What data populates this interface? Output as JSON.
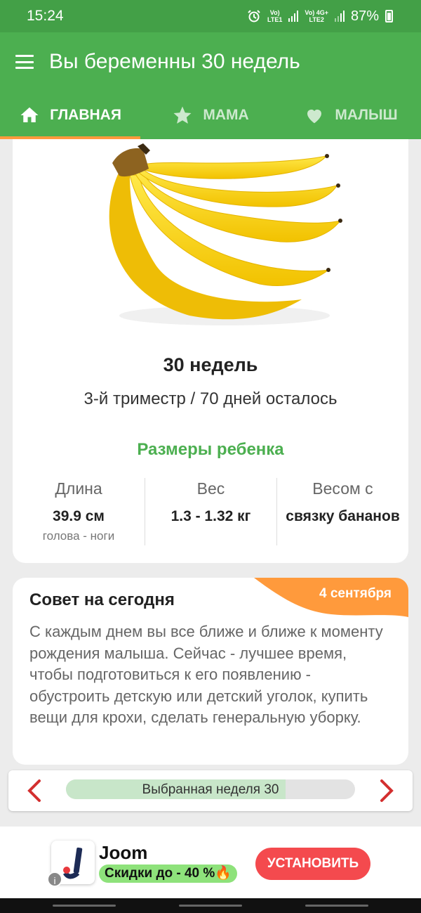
{
  "status_bar": {
    "time": "15:24",
    "net1_top": "Vo)",
    "net1_bottom": "LTE1",
    "net2_top": "Vo) 4G+",
    "net2_bottom": "LTE2",
    "battery": "87%",
    "icons": [
      "alarm-icon",
      "signal-icon",
      "signal-icon",
      "battery-charging-icon"
    ]
  },
  "app_bar": {
    "title": "Вы беременны 30 недель",
    "menu_icon": "hamburger-icon"
  },
  "tabs": [
    {
      "label": "ГЛАВНАЯ",
      "icon": "home-icon",
      "active": true
    },
    {
      "label": "МАМА",
      "icon": "star-icon",
      "active": false
    },
    {
      "label": "МАЛЫШ",
      "icon": "heart-icon",
      "active": false
    }
  ],
  "week_info": {
    "image": "banana-bunch",
    "weeks": "30 недель",
    "trimester": "3-й триместр / 70 дней осталось",
    "sizes_title": "Размеры ребенка",
    "stats": [
      {
        "label": "Длина",
        "value": "39.9 см",
        "sub": "голова - ноги"
      },
      {
        "label": "Вес",
        "value": "1.3 - 1.32 кг",
        "sub": ""
      },
      {
        "label": "Весом с",
        "value": "связку бананов",
        "sub": ""
      }
    ]
  },
  "tip": {
    "title": "Совет на сегодня",
    "date": "4 сентября",
    "text": "С каждым днем вы все ближе и ближе к моменту рождения малыша. Сейчас - лучшее время, чтобы подготовиться к его появлению - обустроить детскую или детский уголок, купить вещи для крохи, сделать генеральную уборку."
  },
  "week_nav": {
    "label": "Выбранная неделя 30",
    "progress": 0.76,
    "prev_icon": "chevron-left-icon",
    "next_icon": "chevron-right-icon"
  },
  "ad": {
    "title": "Joom",
    "promo": "Скидки до - 40 %🔥",
    "button": "УСТАНОВИТЬ",
    "info_icon": "info-icon"
  },
  "colors": {
    "primary": "#4caf50",
    "status_bar": "#43a047",
    "accent": "#ff9a3c",
    "arrow": "#d32f2f",
    "install": "#f44a4e"
  }
}
